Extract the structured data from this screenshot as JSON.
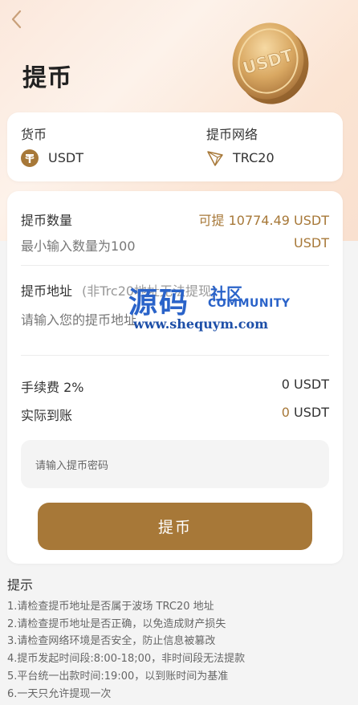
{
  "page": {
    "title": "提币"
  },
  "currency": {
    "label": "货币",
    "value": "USDT",
    "icon": "tether-icon"
  },
  "network": {
    "label": "提币网络",
    "value": "TRC20",
    "icon": "tron-icon"
  },
  "amount": {
    "label": "提币数量",
    "available": "可提 10774.49 USDT",
    "placeholder": "最小输入数量为100",
    "unit": "USDT"
  },
  "address": {
    "label": "提币地址",
    "note": "(非Trc20地址无法提现)",
    "placeholder": "请输入您的提币地址"
  },
  "fee": {
    "label": "手续费 2%",
    "value": "0 USDT"
  },
  "received": {
    "label": "实际到账",
    "amount": "0",
    "unit": "USDT"
  },
  "password": {
    "placeholder": "请输入提币密码"
  },
  "submit_label": "提币",
  "tips": {
    "title": "提示",
    "items": [
      "1.请检查提币地址是否属于波场 TRC20 地址",
      "2.请检查提币地址是否正确，以免造成财产损失",
      "3.请检查网络环境是否安全，防止信息被篡改",
      "4.提币发起时间段:8:00-18;00，非时间段无法提款",
      "5.平台统一出款时间:19:00，以到账时间为基准",
      "6.一天只允许提现一次"
    ]
  },
  "watermark": {
    "main": "源码",
    "side": "社区",
    "en": "COMMUNITY",
    "url": "www.shequym.com"
  },
  "coin_text": "USDT",
  "colors": {
    "accent": "#a77838",
    "tether": "#a77838"
  }
}
